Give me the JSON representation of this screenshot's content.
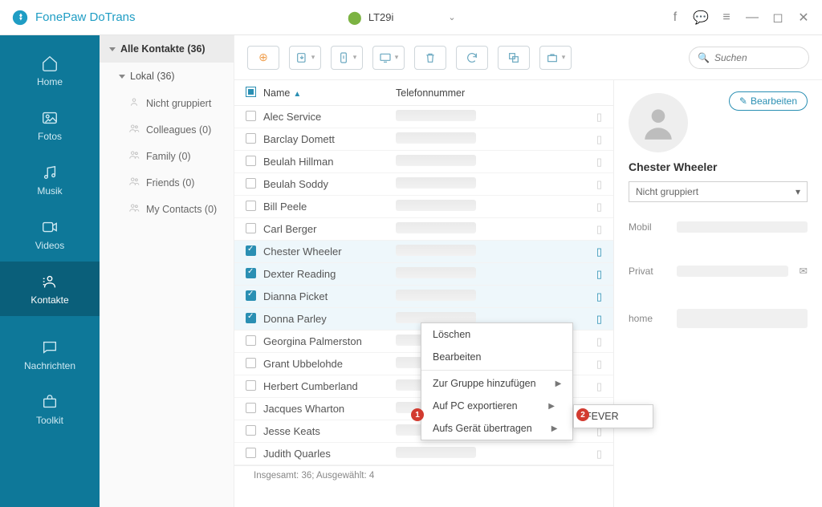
{
  "app": {
    "title": "FonePaw DoTrans",
    "device": "LT29i"
  },
  "nav": {
    "items": [
      {
        "label": "Home"
      },
      {
        "label": "Fotos"
      },
      {
        "label": "Musik"
      },
      {
        "label": "Videos"
      },
      {
        "label": "Kontakte"
      },
      {
        "label": "Nachrichten"
      },
      {
        "label": "Toolkit"
      }
    ]
  },
  "tree": {
    "all_label": "Alle Kontakte  (36)",
    "local_label": "Lokal  (36)",
    "groups": [
      {
        "label": "Nicht gruppiert"
      },
      {
        "label": "Colleagues  (0)"
      },
      {
        "label": "Family  (0)"
      },
      {
        "label": "Friends  (0)"
      },
      {
        "label": "My Contacts  (0)"
      }
    ]
  },
  "table": {
    "col_name": "Name",
    "col_phone": "Telefonnummer",
    "rows": [
      {
        "name": "Alec Service",
        "sel": false
      },
      {
        "name": "Barclay Domett",
        "sel": false
      },
      {
        "name": "Beulah Hillman",
        "sel": false
      },
      {
        "name": "Beulah Soddy",
        "sel": false
      },
      {
        "name": "Bill Peele",
        "sel": false
      },
      {
        "name": "Carl Berger",
        "sel": false
      },
      {
        "name": "Chester Wheeler",
        "sel": true
      },
      {
        "name": "Dexter Reading",
        "sel": true
      },
      {
        "name": "Dianna Picket",
        "sel": true
      },
      {
        "name": "Donna Parley",
        "sel": true
      },
      {
        "name": "Georgina Palmerston",
        "sel": false
      },
      {
        "name": "Grant Ubbelohde",
        "sel": false
      },
      {
        "name": "Herbert Cumberland",
        "sel": false
      },
      {
        "name": "Jacques Wharton",
        "sel": false
      },
      {
        "name": "Jesse Keats",
        "sel": false
      },
      {
        "name": "Judith Quarles",
        "sel": false
      }
    ]
  },
  "status": "Insgesamt: 36; Ausgewählt: 4",
  "search": {
    "placeholder": "Suchen"
  },
  "detail": {
    "edit": "Bearbeiten",
    "name": "Chester Wheeler",
    "group": "Nicht gruppiert",
    "fields": {
      "mobile": "Mobil",
      "private": "Privat",
      "home": "home"
    }
  },
  "context": {
    "delete": "Löschen",
    "edit": "Bearbeiten",
    "to_group": "Zur Gruppe hinzufügen",
    "export_pc": "Auf PC exportieren",
    "to_device": "Aufs Gerät übertragen",
    "device_target": "FEVER"
  },
  "badges": {
    "one": "1",
    "two": "2"
  }
}
